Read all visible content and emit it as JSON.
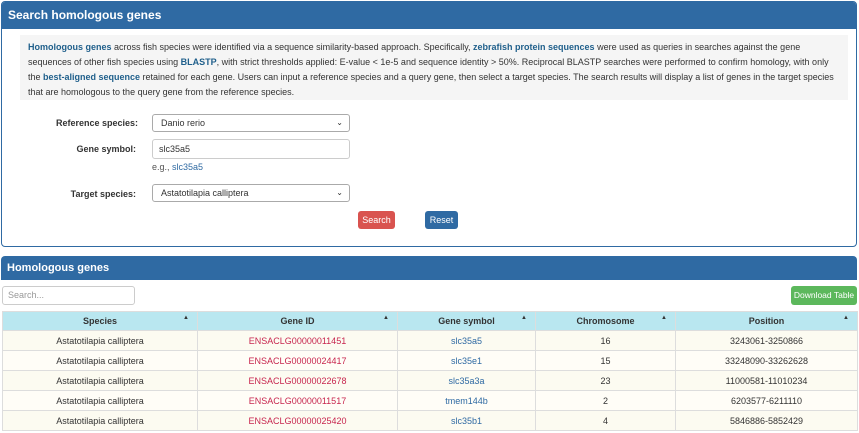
{
  "search_panel": {
    "title": "Search homologous genes",
    "intro": {
      "p1_hl": "Homologous genes",
      "p1": " across fish species were identified via a sequence similarity-based approach. Specifically, ",
      "p2_hl": "zebrafish protein sequences",
      "p2": " were used as queries in searches against the gene sequences of other fish species using ",
      "p3_hl": "BLASTP",
      "p3": ", with strict thresholds applied: E-value < 1e-5 and sequence identity > 50%. Reciprocal BLASTP searches were performed to confirm homology, with only the ",
      "p4_hl": "best-aligned sequence",
      "p4": " retained for each gene. Users can input a reference species and a query gene, then select a target species. The search results will display a list of genes in the target species that are homologous to the query gene from the reference species."
    },
    "reference_label": "Reference species:",
    "reference_value": "Danio rerio",
    "gene_label": "Gene symbol:",
    "gene_value": "slc35a5",
    "hint_prefix": "e.g., ",
    "hint_link": "slc35a5",
    "target_label": "Target species:",
    "target_value": "Astatotilapia calliptera",
    "search_button": "Search",
    "reset_button": "Reset"
  },
  "results_panel": {
    "title": "Homologous genes",
    "search_placeholder": "Search...",
    "download_button": "Download Table",
    "columns": [
      "Species",
      "Gene ID",
      "Gene symbol",
      "Chromosome",
      "Position"
    ],
    "rows": [
      [
        "Astatotilapia calliptera",
        "ENSACLG00000011451",
        "slc35a5",
        "16",
        "3243061-3250866"
      ],
      [
        "Astatotilapia calliptera",
        "ENSACLG00000024417",
        "slc35e1",
        "15",
        "33248090-33262628"
      ],
      [
        "Astatotilapia calliptera",
        "ENSACLG00000022678",
        "slc35a3a",
        "23",
        "11000581-11010234"
      ],
      [
        "Astatotilapia calliptera",
        "ENSACLG00000011517",
        "tmem144b",
        "2",
        "6203577-6211110"
      ],
      [
        "Astatotilapia calliptera",
        "ENSACLG00000025420",
        "slc35b1",
        "4",
        "5846886-5852429"
      ]
    ]
  },
  "colors": {
    "header_blue": "#2f6aa3",
    "danger": "#d9534f",
    "success": "#5cb85c",
    "table_header": "#b9e7f0",
    "gene_id": "#c7254e"
  }
}
